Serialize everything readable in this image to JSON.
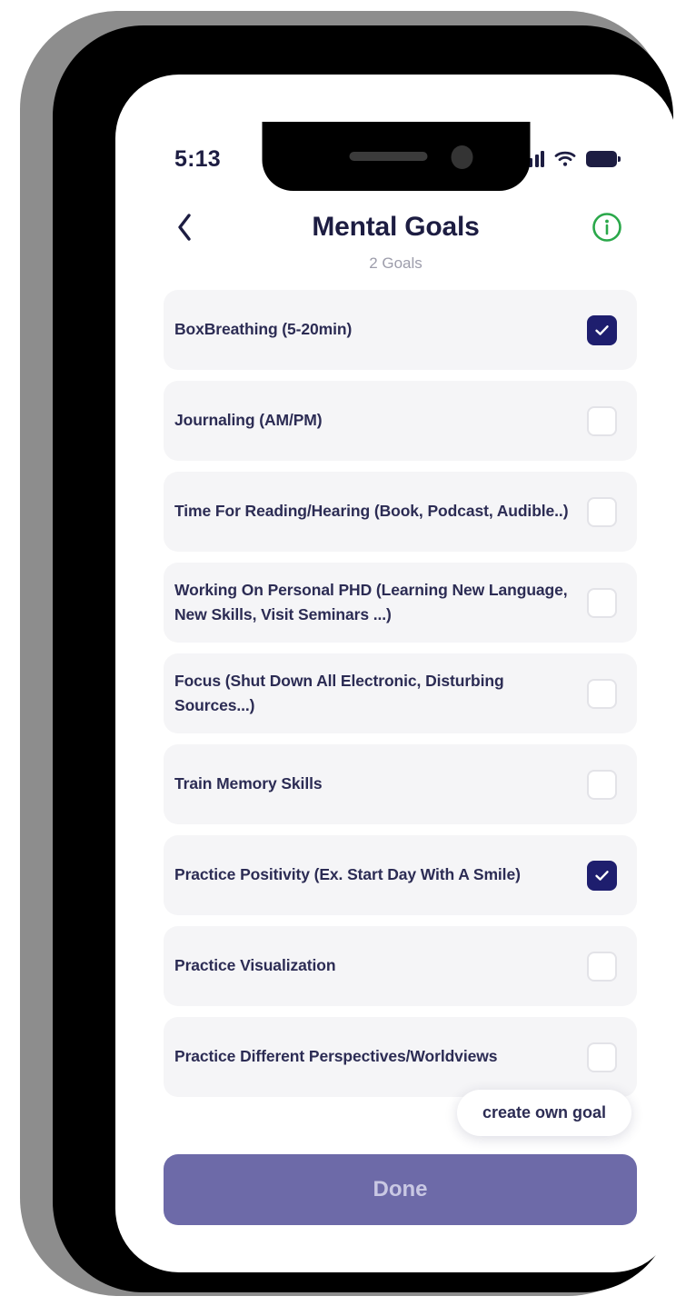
{
  "status_bar": {
    "time": "5:13",
    "signal_icon": "signal-bars-icon",
    "wifi_icon": "wifi-icon",
    "battery_icon": "battery-full-icon"
  },
  "header": {
    "back_icon": "chevron-left-icon",
    "title": "Mental Goals",
    "subtitle": "2 Goals",
    "info_icon": "info-circle-icon",
    "info_color": "#2aa84a"
  },
  "goals": [
    {
      "label": "BoxBreathing (5-20min)",
      "checked": true
    },
    {
      "label": "Journaling (AM/PM)",
      "checked": false
    },
    {
      "label": "Time For Reading/Hearing (Book, Podcast, Audible..)",
      "checked": false
    },
    {
      "label": "Working On Personal PHD (Learning New Language, New Skills, Visit Seminars ...)",
      "checked": false
    },
    {
      "label": "Focus (Shut Down All Electronic, Disturbing Sources...)",
      "checked": false
    },
    {
      "label": "Train Memory Skills",
      "checked": false
    },
    {
      "label": "Practice Positivity (Ex. Start Day With A Smile)",
      "checked": true
    },
    {
      "label": "Practice Visualization",
      "checked": false
    },
    {
      "label": "Practice Different Perspectives/Worldviews",
      "checked": false
    }
  ],
  "create_pill": {
    "label": "create own goal"
  },
  "done_button": {
    "label": "Done"
  },
  "colors": {
    "accent_navy": "#1e1e6e",
    "text_navy": "#2c2c54",
    "card_bg": "#f5f5f7",
    "done_bg": "#6d6aa8",
    "done_text": "#c9c8e3",
    "info_green": "#2aa84a",
    "subtitle_gray": "#9d9dab"
  }
}
